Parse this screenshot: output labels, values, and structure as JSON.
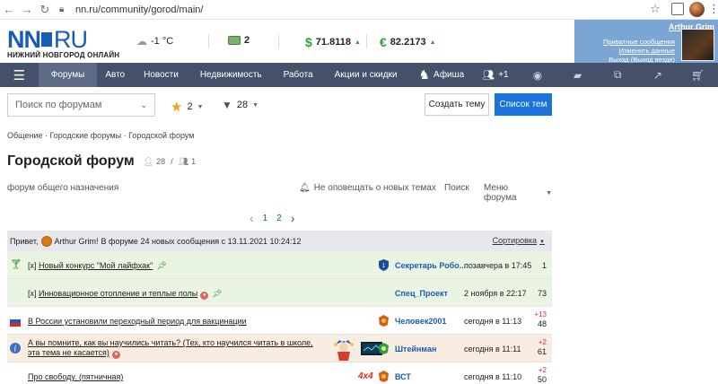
{
  "browser": {
    "url": "nn.ru/community/gorod/main/"
  },
  "header": {
    "logo_main": "NN",
    "logo_ru": "RU",
    "logo_sub": "НИЖНИЙ НОВГОРОД ОНЛАЙН",
    "weather": "-1 °C",
    "traffic": "2",
    "usd_symbol": "$",
    "usd": "71.8118",
    "eur_symbol": "€",
    "eur": "82.2173",
    "up_arrow": "▲"
  },
  "login": {
    "name": "Arthur Grim",
    "private_messages": "Приватные сообщения",
    "edit_data": "Изменить данные",
    "logout": "Выход (Выход везде)"
  },
  "nav": {
    "items": [
      "Форумы",
      "Авто",
      "Новости",
      "Недвижимость",
      "Работа",
      "Акции и скидки"
    ],
    "afisha": "Афиша",
    "friends": "+1"
  },
  "toolbar": {
    "search_placeholder": "Поиск по форумам",
    "favorites": "2",
    "filters": "28",
    "create_topic": "Создать тему",
    "topic_list": "Список тем"
  },
  "breadcrumb": "Общение  ·  Городские форумы  ·  Городской форум",
  "page": {
    "title": "Городской форум",
    "members": "28",
    "online": "1",
    "description": "форум общего назначения",
    "notify": "Не оповещать о новых темах",
    "search": "Поиск",
    "menu": "Меню форума"
  },
  "pager": {
    "prev": "‹",
    "pages": [
      "1",
      "2"
    ],
    "next": "›"
  },
  "greeting": {
    "prefix": "Привет,",
    "user": "Arthur Grim!",
    "text": "В форуме 24 новых сообщения с 13.11.2021 10:24:12",
    "sort": "Сортировка"
  },
  "topics": [
    {
      "prefix": "[x] ",
      "title": "Новый конкурс \"Мой лайфхак\"",
      "author": "Секретарь Робо...",
      "date": "позавчера в 17:45",
      "count": "1",
      "new": ""
    },
    {
      "prefix": "[x] ",
      "title": "Инновационное отопление и теплые полы",
      "author": "Спец_Проект",
      "date": "2 ноября в 22:17",
      "count": "73",
      "new": ""
    },
    {
      "prefix": "",
      "title": "В России установили переходный период для вакцинации",
      "author": "Человек2001",
      "date": "сегодня в 11:13",
      "count": "48",
      "new": "+13"
    },
    {
      "prefix": "",
      "title": "А вы помните, как вы научились читать? (Тех, кто научился читать в школе, эта тема не касается)",
      "author": "Штейнман",
      "date": "сегодня в 11:11",
      "count": "61",
      "new": "+2"
    },
    {
      "prefix": "",
      "title": "Про свободу. (пятничная)",
      "author": "ВСТ",
      "date": "сегодня в 11:10",
      "count": "50",
      "new": "+2",
      "deco": "4x4"
    }
  ]
}
